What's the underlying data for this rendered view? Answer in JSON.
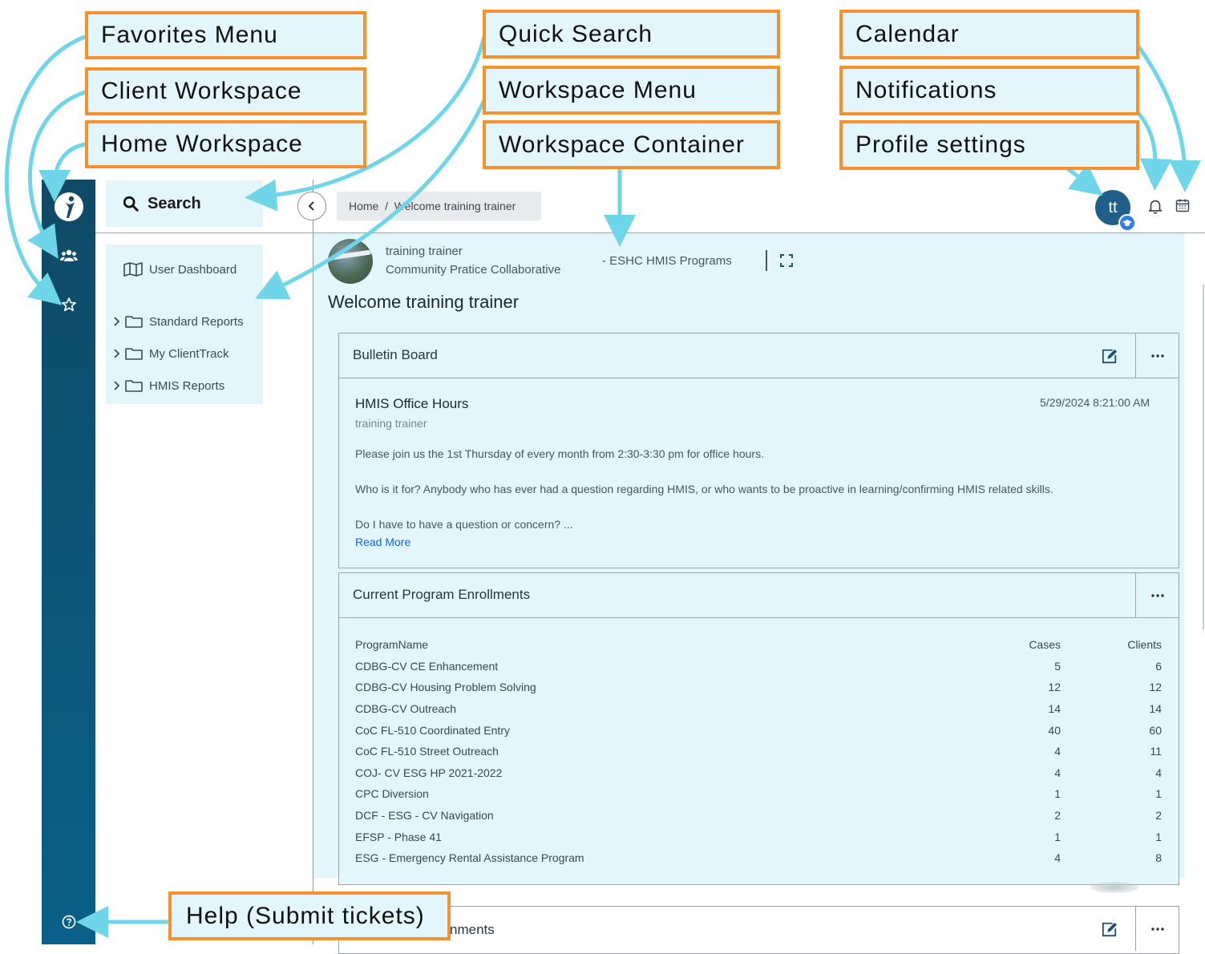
{
  "callouts": {
    "favorites": "Favorites Menu",
    "client_ws": "Client Workspace",
    "home_ws": "Home Workspace",
    "quick_search": "Quick Search",
    "ws_menu": "Workspace Menu",
    "ws_container": "Workspace Container",
    "calendar": "Calendar",
    "notifications": "Notifications",
    "profile": "Profile settings",
    "help": "Help (Submit tickets)"
  },
  "colors": {
    "callout_border": "#f7912e",
    "arrow": "#6fd6ea",
    "sidebar": "#0f4a66",
    "panel_bg": "#e2f6fb",
    "link": "#1565e0"
  },
  "sidebar": {
    "icons": [
      "logo-icon",
      "users-icon",
      "star-icon",
      "help-circle-icon"
    ]
  },
  "search": {
    "label": "Search",
    "icon": "search-icon"
  },
  "nav": {
    "items": [
      {
        "label": "User Dashboard",
        "icon": "map-icon"
      },
      {
        "label": "Standard Reports",
        "icon": "folder-icon"
      },
      {
        "label": "My ClientTrack",
        "icon": "folder-icon"
      },
      {
        "label": "HMIS Reports",
        "icon": "folder-icon"
      }
    ]
  },
  "breadcrumb": {
    "text": "Home  /  Welcome training trainer"
  },
  "profile": {
    "initials": "tt"
  },
  "workspace": {
    "user_name": "training trainer",
    "org_name": "Community Pratice Collaborative",
    "program": "- ESHC HMIS Programs",
    "page_title": "Welcome training trainer"
  },
  "bulletin": {
    "title": "Bulletin Board",
    "post_title": "HMIS Office Hours",
    "post_date": "5/29/2024 8:21:00 AM",
    "post_author": "training trainer",
    "lines": [
      "Please join us the 1st Thursday of every month from 2:30-3:30 pm for office hours.",
      "Who is it for?  Anybody who has ever had a question regarding HMIS, or who wants to be proactive in learning/confirming HMIS related skills.",
      "Do I have to have a question or concern? ..."
    ],
    "read_more": "Read More"
  },
  "enrollments": {
    "title": "Current Program Enrollments",
    "headers": [
      "ProgramName",
      "Cases",
      "Clients"
    ],
    "rows": [
      [
        "CDBG-CV CE Enhancement",
        "5",
        "6"
      ],
      [
        "CDBG-CV Housing Problem Solving",
        "12",
        "12"
      ],
      [
        "CDBG-CV Outreach",
        "14",
        "14"
      ],
      [
        "CoC FL-510 Coordinated Entry",
        "40",
        "60"
      ],
      [
        "CoC FL-510 Street Outreach",
        "4",
        "11"
      ],
      [
        "COJ- CV ESG HP 2021-2022",
        "4",
        "4"
      ],
      [
        "CPC Diversion",
        "1",
        "1"
      ],
      [
        "DCF - ESG - CV Navigation",
        "2",
        "2"
      ],
      [
        "EFSP - Phase 41",
        "1",
        "1"
      ],
      [
        "ESG - Emergency Rental Assistance Program",
        "4",
        "8"
      ]
    ]
  },
  "third_panel": {
    "title_partial": "nments"
  }
}
